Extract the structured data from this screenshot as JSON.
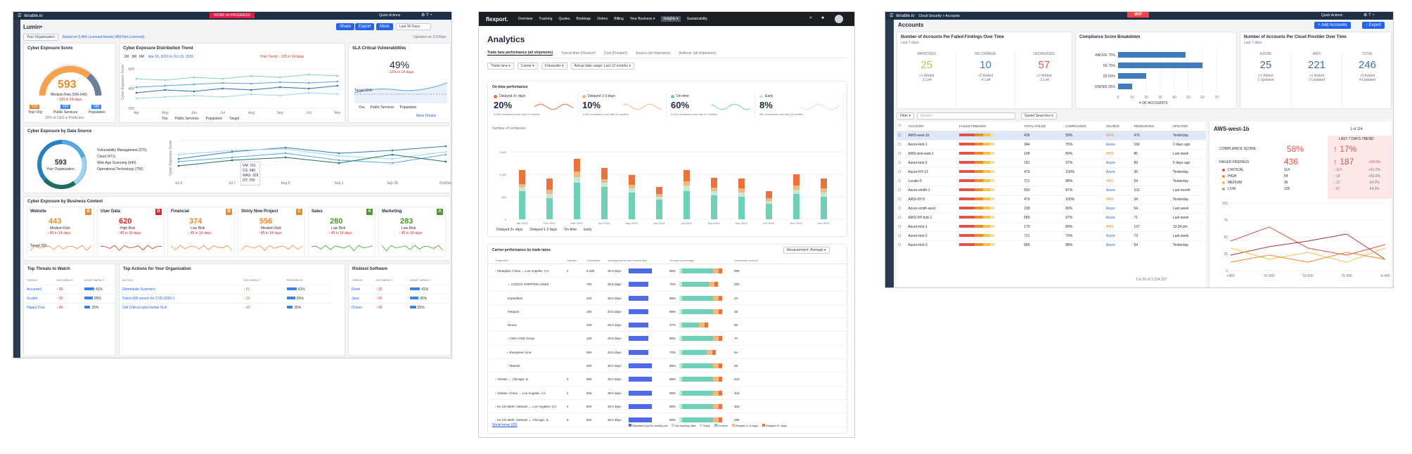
{
  "p1": {
    "brand": "tenable.io",
    "banner": "WORK IN PROGRESS",
    "quick_actions": "Quick Actions",
    "app": "Lumin",
    "share": "Share",
    "export": "Export",
    "more": "More",
    "range": "Last 90 Days",
    "org": "Your Organization",
    "based": "Based on 5,456 Licensed Assets (459 Not Licensed)",
    "updated": "Updated on 10:00am",
    "ces": {
      "title": "Cyber Exposure Score",
      "score": "593",
      "risk": "Medium Risk (590-649)",
      "delta": "↑ 125 in 14 days",
      "legend_org": "Your Org",
      "legend_pub": "Public Services",
      "legend_pop": "Population",
      "v1": "593",
      "v2": "650",
      "v3": "580",
      "note": "20% of CES is Predicted"
    },
    "trend": {
      "title": "Cyber Exposure Distribution Trend",
      "tabs": [
        "1M",
        "3M",
        "6M"
      ],
      "dates": "Apr 16, 2020 to Oct 15, 2020",
      "delta": "Your Trend ↑ 125 in 14 days",
      "ylabel": "Cyber Exposure Score",
      "y": [
        "600",
        "400",
        "200"
      ],
      "x": [
        "Apr",
        "May",
        "Jun",
        "Jul",
        "Aug",
        "Sep",
        "Oct",
        "Nov"
      ],
      "legend": [
        "You",
        "Public Services",
        "Population",
        "Target"
      ]
    },
    "sla": {
      "title": "SLA Critical Vulnerabilities",
      "pct": "49%",
      "delta": "↑ 12% in 14 days",
      "target": "Target 55%",
      "legend": [
        "You",
        "Public Services",
        "Population"
      ],
      "more": "More Details"
    },
    "source": {
      "title": "Cyber Exposure by Data Source",
      "score": "593",
      "sub": "Your Organization",
      "items": [
        "Vulnerability Management (275)",
        "Cloud (471)",
        "Web App Scanning (640)",
        "Operational Technology (756)"
      ],
      "ylabel": "Cyber Exposure Score",
      "x": [
        "Jul 6",
        "Jul 7",
        "Aug 8",
        "Sep 1",
        "Sep 28",
        "Oct/Nov"
      ],
      "tip": [
        "VM: 761",
        "CS: 580",
        "WAS: 329",
        "OT: 700"
      ]
    },
    "biz": {
      "title": "Cyber Exposure by Business Context",
      "cards": [
        {
          "name": "Website",
          "grade": "B",
          "score": "443",
          "risk": "Medium Risk",
          "delta": "↑ 45 in 14 days",
          "target": "Target 356"
        },
        {
          "name": "User Data",
          "grade": "D",
          "score": "620",
          "risk": "High Risk",
          "delta": "↑ 45 in 14 days"
        },
        {
          "name": "Financial",
          "grade": "B",
          "score": "374",
          "risk": "Low Risk",
          "delta": "↑ 45 in 14 days"
        },
        {
          "name": "Shiny New Project",
          "grade": "C",
          "score": "556",
          "risk": "Medium Risk",
          "delta": "↑ 45 in 14 days"
        },
        {
          "name": "Sales",
          "grade": "A",
          "score": "280",
          "risk": "Low Risk",
          "delta": "↑ 45 in 14 days"
        },
        {
          "name": "Marketing",
          "grade": "A",
          "score": "283",
          "risk": "Low Risk",
          "delta": "↑ 45 in 14 days"
        }
      ]
    },
    "threats": {
      "title": "Top Threats to Watch",
      "cols": [
        "THREAT",
        "CES IMPACT",
        "ASSET IMPACT"
      ],
      "rows": [
        [
          "Accumed",
          "↑ 60",
          "41%"
        ],
        [
          "Scarlet",
          "↑ 50",
          "35%"
        ],
        [
          "Happy Cow",
          "↑ 40",
          "25%"
        ]
      ]
    },
    "actions": {
      "title": "Top Actions for Your Organization",
      "cols": [
        "ACTION",
        "CES IMPACT",
        "PROGRESS"
      ],
      "rows": [
        [
          "Remediate Scanners",
          "↓ 61",
          "41%"
        ],
        [
          "Patch 499 assets for CVE-2020-1",
          "↓ 53",
          "35%"
        ],
        [
          "Get Critical vulns below SLA",
          "↓ 43",
          "25%"
        ]
      ]
    },
    "software": {
      "title": "Riskiest Software",
      "cols": [
        "THREAT",
        "CES IMPACT",
        "ASSET IMPACT"
      ],
      "rows": [
        [
          "Flash",
          "↑ 60",
          "41%"
        ],
        [
          "Java",
          "↑ 50",
          "35%"
        ],
        [
          "iTunes",
          "↑ 40",
          "25%"
        ]
      ]
    }
  },
  "p2": {
    "brand": "flexport.",
    "nav": [
      "Overview",
      "Tracking",
      "Quotes",
      "Bookings",
      "Orders",
      "Billing",
      "Your Business ▾",
      "Insights ▾",
      "Sustainability"
    ],
    "title": "Analytics",
    "tabs": [
      "Trade lane performance (all shipments)",
      "Transit time (Flexport)",
      "Cost (Flexport)",
      "Source (all shipments)",
      "Rollover (all shipments)"
    ],
    "filters": [
      "Trade lane ▾",
      "Carrier ▾",
      "Forwarder ▾",
      "Arrival date range: Last 12 months ▾"
    ],
    "ontime": {
      "title": "On-time performance",
      "kpis": [
        {
          "label": "Delayed 3+ days",
          "value": "20%",
          "sub": "3,000 containers over last 12 months",
          "color": "#e8743b"
        },
        {
          "label": "Delayed 1-3 days",
          "value": "10%",
          "sub": "1,500 containers over last 12 months",
          "color": "#f2b880"
        },
        {
          "label": "On-time",
          "value": "60%",
          "sub": "9,000 containers over last 12 months",
          "color": "#6fd0b8"
        },
        {
          "label": "Early",
          "value": "8%",
          "sub": "980 containers over last 12 months",
          "color": "#c6e9d6"
        }
      ]
    },
    "chart_ylabel": "Number of containers",
    "chart_legend": [
      "Delayed 3+ days",
      "Delayed 1-3 days",
      "On-time",
      "Early"
    ],
    "carrier_title": "Carrier performance by trade lanes",
    "measurement": "Measurement: Average ▾",
    "cols": [
      "Trade lane",
      "Carriers",
      "Containers",
      "Average port-to-port transit time",
      "On-time percentage",
      "Containers on-time"
    ],
    "rows": [
      {
        "lane": "› Shanghai, China → Los Angeles, CA",
        "c": "4",
        "n": "3,330",
        "t": "30.0 days",
        "p": "88%",
        "o": "865"
      },
      {
        "lane": "⌄ COSCO SHIPPING LINES",
        "c": "",
        "n": "700",
        "t": "25.5 days",
        "p": "76%",
        "o": "250"
      },
      {
        "lane": "Expeditors",
        "c": "",
        "n": "100",
        "t": "25.5 days",
        "p": "88%",
        "o": "23"
      },
      {
        "lane": "Flexport",
        "c": "",
        "n": "100",
        "t": "25.5 days",
        "p": "88%",
        "o": "36"
      },
      {
        "lane": "Nexus",
        "c": "",
        "n": "100",
        "t": "25.5 days",
        "p": "47%",
        "o": "98"
      },
      {
        "lane": "› CMA CGM Group",
        "c": "",
        "n": "100",
        "t": "25.5 days",
        "p": "88%",
        "o": "70"
      },
      {
        "lane": "› Evergreen Line",
        "c": "",
        "n": "300",
        "t": "25.5 days",
        "p": "70%",
        "o": "64"
      },
      {
        "lane": "› Maersk",
        "c": "",
        "n": "300",
        "t": "30.0 days",
        "p": "88%",
        "o": "49"
      },
      {
        "lane": "› Yantian → Chicago, IL",
        "c": "3",
        "n": "900",
        "t": "30.0 days",
        "p": "88%",
        "o": "423"
      },
      {
        "lane": "› Yantian, China → Los Angeles, CA",
        "c": "4",
        "n": "600",
        "t": "30.0 days",
        "p": "88%",
        "o": "404"
      },
      {
        "lane": "› Ho Chi Minh, Vietnam → Los Angeles, CA",
        "c": "4",
        "n": "600",
        "t": "30.0 days",
        "p": "88%",
        "o": "303"
      },
      {
        "lane": "› Ho Chi Minh, Vietnam → Chicago, IL",
        "c": "5",
        "n": "600",
        "t": "30.0 days",
        "p": "88%",
        "o": "295"
      }
    ],
    "show_more": "Show more (20)",
    "legend2": [
      "Departure port to arrival port",
      "No tracking data",
      "Early",
      "On-time",
      "Delayed 1–3 days",
      "Delayed 3+ days"
    ]
  },
  "p3": {
    "brand": "tenable.io",
    "crumb": "Cloud Security > Accounts",
    "wip": "WIP",
    "quick_actions": "Quick Actions",
    "title": "Accounts",
    "add": "+ Add Accounts",
    "export": "↑ Export",
    "c1": {
      "title": "Number of Accounts Per Failed Findings Over Time",
      "sub": "Last 7 days",
      "cols": [
        {
          "h": "IMPROVED",
          "v": "25",
          "a": "+1 Added",
          "b": "-2 Left",
          "color": "#b7c843"
        },
        {
          "h": "NO CHANGE",
          "v": "10",
          "a": "+2 Added",
          "b": "-4 Left",
          "color": "#3e7bbf"
        },
        {
          "h": "DECREASED",
          "v": "57",
          "a": "+7 Added",
          "b": "-3 Left",
          "color": "#e45b4c"
        }
      ]
    },
    "c2": {
      "title": "Compliance Score Breakdown",
      "bars": [
        "ABOVE 75%",
        "50-75%",
        "25-50%",
        "UNDER 25%"
      ],
      "xlabel": "# OF ACCOUNTS",
      "x": [
        "0",
        "10",
        "20",
        "30",
        "40",
        "50",
        "60",
        "70"
      ]
    },
    "c3": {
      "title": "Number of Accounts Per Cloud Provider Over Time",
      "sub": "Last 7 days",
      "cols": [
        {
          "h": "AZURE",
          "v": "25",
          "a": "+1 Added",
          "b": "2 Updated"
        },
        {
          "h": "AWS",
          "v": "221",
          "a": "+1 Added",
          "b": "2 Updated"
        },
        {
          "h": "TOTAL",
          "v": "246",
          "a": "+2 Added",
          "b": "4 Updated"
        }
      ]
    },
    "filter": "Filter ▾",
    "search": "Search",
    "saved": "Saved Searches ▾",
    "cols": [
      "ACCOUNT",
      "FAILED FINDINGS",
      "TOTAL FAILED",
      "COMPLIANCE",
      "SOURCE",
      "RESOURCES",
      "UPDATED"
    ],
    "rows": [
      [
        "AWS-west-1b",
        "436",
        "58%",
        "AWS",
        "476",
        "Yesterday"
      ],
      [
        "Azure-test-1",
        "344",
        "75%",
        "Azure",
        "156",
        "2 days ago"
      ],
      [
        "AWS-test-east-1",
        "198",
        "89%",
        "AWS",
        "86",
        "Last week"
      ],
      [
        "Azure-test-2",
        "181",
        "97%",
        "Azure",
        "89",
        "5 days ago"
      ],
      [
        "Azure-NY-12",
        "479",
        "100%",
        "Azure",
        "36",
        "Yesterday"
      ],
      [
        "Locale-5",
        "721",
        "88%",
        "AWS",
        "54",
        "Yesterday"
      ],
      [
        "Azure-smith-1",
        "550",
        "87%",
        "Azure",
        "101",
        "Last month"
      ],
      [
        "AWS-NY-5",
        "479",
        "100%",
        "AWS",
        "34",
        "Yesterday"
      ],
      [
        "Azure-smith-west",
        "198",
        "80%",
        "Azure",
        "54",
        "Last week"
      ],
      [
        "AWS-NY-hub-1",
        "589",
        "97%",
        "Azure",
        "71",
        "Last week"
      ],
      [
        "Azure-test-1",
        "179",
        "89%",
        "AWS",
        "137",
        "12:34 pm"
      ],
      [
        "Azure-test-2",
        "721",
        "79%",
        "Azure",
        "73",
        "Last week"
      ],
      [
        "Azure-test-3",
        "689",
        "88%",
        "Azure",
        "54",
        "Yesterday"
      ]
    ],
    "pager": "1 to 50 of 1,234,197",
    "detail": {
      "title": "AWS-west-1b",
      "page": "1 of 114",
      "trend": "LAST 7 DAYS TREND",
      "comp_label": "COMPLIANCE SCORE",
      "comp": "58%",
      "comp_delta": "↑ 17%",
      "fail_label": "FAILED FINDINGS",
      "fail": "436",
      "fail_delta": "↑ 187",
      "fail_pct": "+58.5%",
      "sev": [
        [
          "CRITICAL",
          "114",
          "↑ 114",
          "+41.2%"
        ],
        [
          "HIGH",
          "54",
          "↑ 18",
          "+50.0%"
        ],
        [
          "MEDIUM",
          "36",
          "↓ 12",
          "-34.3%"
        ],
        [
          "LOW",
          "105",
          "↑ 67",
          "-34.3%"
        ]
      ],
      "y": [
        "100",
        "75",
        "50",
        "25",
        "0"
      ],
      "x": [
        "<980",
        "51-900",
        "55-600",
        "75-900",
        "A-400"
      ]
    }
  }
}
